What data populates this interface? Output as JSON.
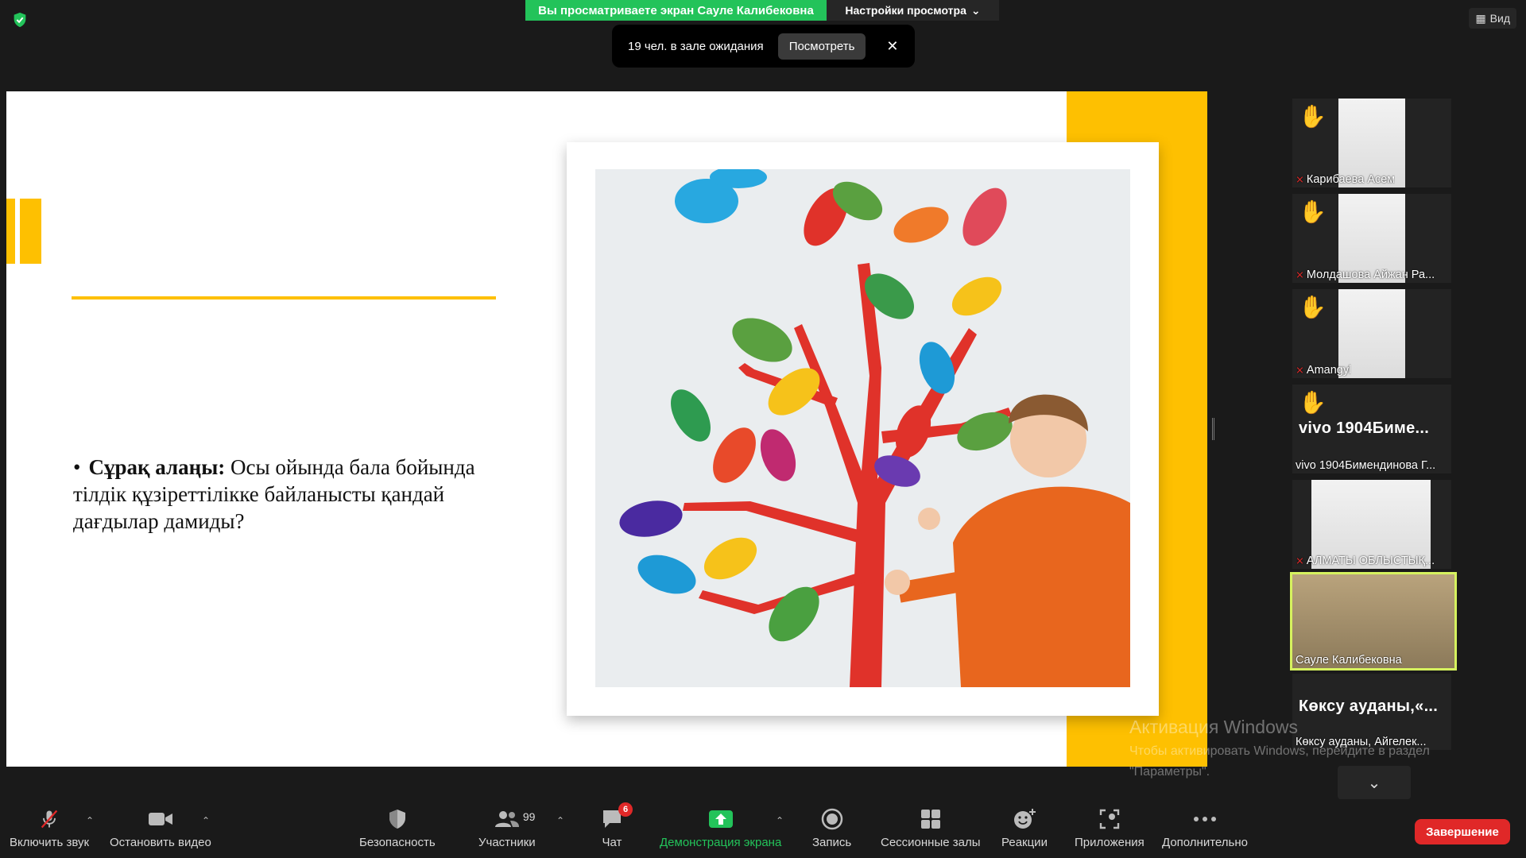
{
  "top": {
    "sharing_banner": "Вы просматриваете экран Сауле Калибековна",
    "view_settings": "Настройки просмотра",
    "view_button": "Вид"
  },
  "waiting_room": {
    "text": "19 чел. в зале ожидания",
    "button": "Посмотреть",
    "close": "✕"
  },
  "slide": {
    "bullet": "•",
    "question_bold": "Сұрақ алаңы:",
    "question_text": " Осы ойында бала бойында тілдік құзіреттілікке байланысты қандай дағдылар дамиды?"
  },
  "participants": [
    {
      "name": "Карибаева Асем",
      "muted": true,
      "hand": true
    },
    {
      "name": "Молдашова Айжан Ра...",
      "muted": true,
      "hand": true
    },
    {
      "name": "Amangyl",
      "muted": true,
      "hand": true
    },
    {
      "name": "vivo 1904Бимендинова Г...",
      "big": "vivo  1904Биме...",
      "muted": false,
      "hand": true
    },
    {
      "name": "АЛМАТЫ ОБЛЫСТЫҚ...",
      "muted": true,
      "hand": false
    },
    {
      "name": "Сауле Калибековна",
      "muted": false,
      "hand": false,
      "active": true
    },
    {
      "name": "Көксу ауданы, Айгелек...",
      "big": "Көксу  ауданы,«...",
      "muted": false,
      "hand": false
    }
  ],
  "watermark": {
    "title": "Активация Windows",
    "text": "Чтобы активировать Windows, перейдите в раздел \"Параметры\"."
  },
  "toolbar": {
    "unmute": "Включить звук",
    "stop_video": "Остановить видео",
    "security": "Безопасность",
    "participants": "Участники",
    "participants_count": "99",
    "chat": "Чат",
    "chat_badge": "6",
    "share": "Демонстрация экрана",
    "record": "Запись",
    "breakout": "Сессионные залы",
    "reactions": "Реакции",
    "apps": "Приложения",
    "more": "Дополнительно",
    "end": "Завершение"
  },
  "colors": {
    "accent_green": "#23c35a",
    "slide_yellow": "#fec001",
    "end_red": "#e02828",
    "active_border": "#d6f25e"
  }
}
